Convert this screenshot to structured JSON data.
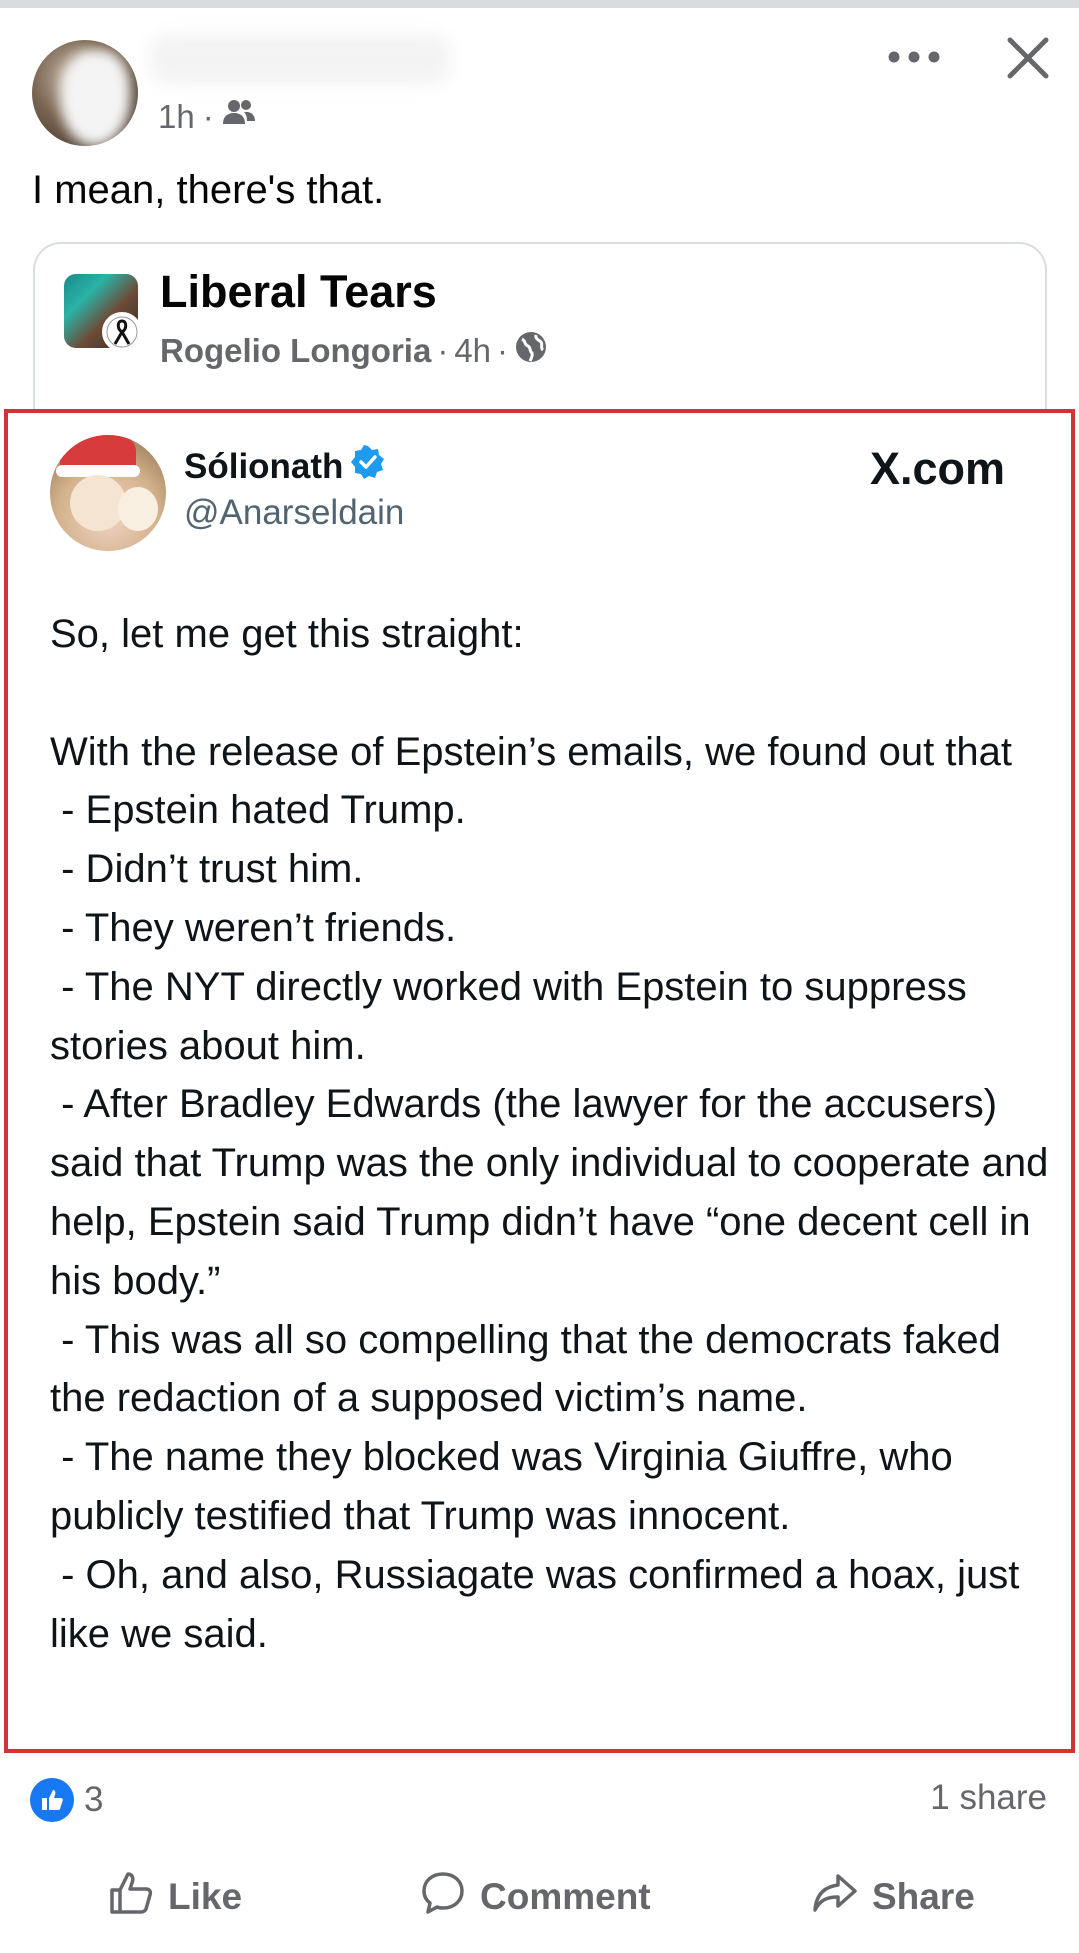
{
  "post": {
    "time": "1h",
    "separator": "·",
    "text": "I mean, there's that."
  },
  "shared": {
    "page_name": "Liberal Tears",
    "author": "Rogelio Longoria",
    "time": "4h",
    "separator1": "·",
    "separator2": "·"
  },
  "tweet": {
    "name": "Sólionath",
    "handle": "@Anarseldain",
    "source": "X.com",
    "paragraphs": [
      "So, let me get this straight:",
      "",
      "With the release of Epstein’s emails, we found out that",
      " - Epstein hated Trump.",
      " - Didn’t trust him.",
      " - They weren’t friends.",
      " - The NYT directly worked with Epstein to suppress stories about him.",
      " - After Bradley Edwards (the lawyer for the accusers) said that Trump was the only individual to cooperate and help, Epstein said Trump didn’t have “one decent cell in his body.”",
      " - This was all so compelling that the democrats faked the redaction of a supposed victim’s name.",
      " - The name they blocked was Virginia Giuffre, who publicly testified that Trump was innocent.",
      " - Oh, and also, Russiagate was confirmed a hoax, just like we said."
    ]
  },
  "footer": {
    "reaction_count": "3",
    "shares": "1 share",
    "like_label": "Like",
    "comment_label": "Comment",
    "share_label": "Share"
  },
  "colors": {
    "facebook_blue": "#1877f2",
    "verified_blue": "#1d9bf0",
    "highlight_red": "#d23333",
    "secondary_text": "#65676b"
  },
  "icons": [
    "friends-audience-icon",
    "more-options-icon",
    "close-icon",
    "globe-icon",
    "verified-badge-icon",
    "like-reaction-icon",
    "thumbs-up-icon",
    "comment-icon",
    "share-arrow-icon"
  ]
}
